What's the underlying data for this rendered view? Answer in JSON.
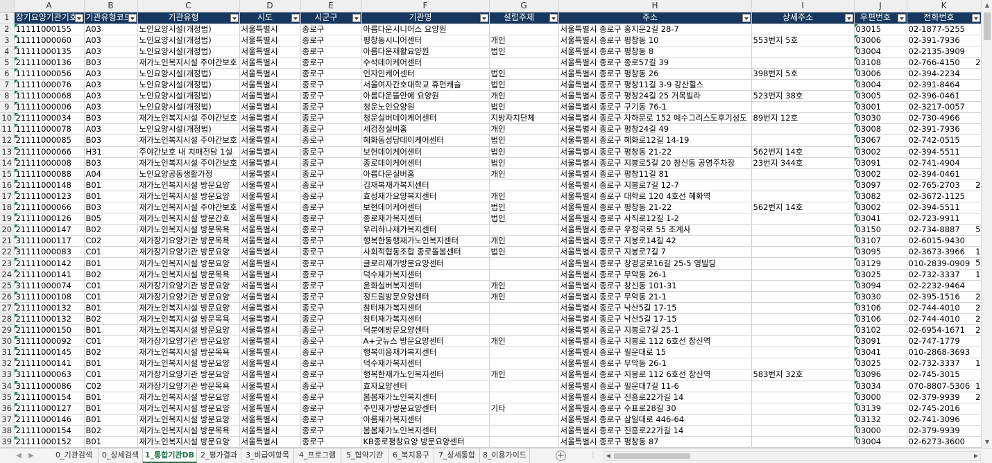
{
  "columns": [
    "A",
    "B",
    "C",
    "D",
    "E",
    "F",
    "G",
    "H",
    "I",
    "J",
    "K"
  ],
  "headers": [
    "장기요양기관기호",
    "기관유형코드",
    "기관유형",
    "시도",
    "시군구",
    "기관명",
    "설립주체",
    "주소",
    "상세주소",
    "우편번호",
    "전화번호"
  ],
  "rows": [
    [
      "11111000155",
      "A03",
      "노인요양시설(개정법)",
      "서울특별시",
      "종로구",
      "아름다운시니어스 요양원",
      "",
      "서울특별시 종로구 홍지문2길 28-7",
      "",
      "03015",
      "02-1877-5255",
      ""
    ],
    [
      "11111000060",
      "A03",
      "노인요양시설(개정법)",
      "서울특별시",
      "종로구",
      "평창동시니어센터",
      "개인",
      "서울특별시 종로구 평창동 10",
      "553번지 5호",
      "03006",
      "02-391-7936",
      ""
    ],
    [
      "11111000135",
      "A03",
      "노인요양시설(개정법)",
      "서울특별시",
      "종로구",
      "아름다운재활요양원",
      "법인",
      "서울특별시 종로구 평창동 8",
      "",
      "03004",
      "02-2135-3909",
      ""
    ],
    [
      "21111000136",
      "B03",
      "재가노인복지시설 주야간보호",
      "서울특별시",
      "종로구",
      "수석데이케어센터",
      "",
      "서울특별시 종로구 종로57길 39",
      "",
      "03108",
      "02-766-4150",
      "2"
    ],
    [
      "11111000056",
      "A03",
      "노인요양시설(개정법)",
      "서울특별시",
      "종로구",
      "인자인케어센터",
      "법인",
      "서울특별시 종로구 평창동 26",
      "398번지 5호",
      "03006",
      "02-394-2234",
      ""
    ],
    [
      "11111000076",
      "A03",
      "노인요양시설(개정법)",
      "서울특별시",
      "종로구",
      "서울여자간호대학교 휴먼캐슬",
      "법인",
      "서울특별시 종로구 평창11길 3-9 강산힐스",
      "",
      "03004",
      "02-391-8464",
      ""
    ],
    [
      "11111000068",
      "A03",
      "노인요양시설(개정법)",
      "서울특별시",
      "종로구",
      "아름다운뜰안에 요양원",
      "개인",
      "서울특별시 종로구 평창24길 25 거목빌라",
      "523번지 38호",
      "03005",
      "02-396-0461",
      ""
    ],
    [
      "11111000006",
      "A03",
      "노인요양시설(개정법)",
      "서울특별시",
      "종로구",
      "청운노인요양원",
      "법인",
      "서울특별시 종로구 구기동 76-1",
      "",
      "03001",
      "02-3217-0057",
      ""
    ],
    [
      "21111000034",
      "B03",
      "재가노인복지시설 주야간보호",
      "서울특별시",
      "종로구",
      "청운실버데이케어센터",
      "지방자치단체",
      "서울특별시 종로구 자하문로 152 예수그리스도후기성도",
      "89번지 12호",
      "03030",
      "02-730-4966",
      ""
    ],
    [
      "11111000078",
      "A03",
      "노인요양시설(개정법)",
      "서울특별시",
      "종로구",
      "세검정실버홈",
      "개인",
      "서울특별시 종로구 평창24길 49",
      "",
      "03008",
      "02-391-7936",
      ""
    ],
    [
      "21111000085",
      "B03",
      "재가노인복지시설 주야간보호",
      "서울특별시",
      "종로구",
      "혜화동성당데이케어센터",
      "법인",
      "서울특별시 종로구 혜화로12길 14-19",
      "",
      "03067",
      "02-742-0515",
      ""
    ],
    [
      "21111000066",
      "H31",
      "주야간보호 내 치매전담 1실",
      "서울특별시",
      "종로구",
      "보현데이케어센터",
      "법인",
      "서울특별시 종로구 평창동 21-22",
      "562번지 14호",
      "03002",
      "02-394-5511",
      ""
    ],
    [
      "21111000008",
      "B03",
      "재가노인복지시설 주야간보호",
      "서울특별시",
      "종로구",
      "종로데이케어센터",
      "법인",
      "서울특별시 종로구 지봉로5길 20 창신동 공영주차장",
      "23번지 344호",
      "03091",
      "02-741-4904",
      ""
    ],
    [
      "11111000088",
      "A04",
      "노인요양공동생활가정",
      "서울특별시",
      "종로구",
      "아름다운실버홈",
      "개인",
      "서울특별시 종로구 평창11길 81",
      "",
      "03002",
      "02-394-0461",
      ""
    ],
    [
      "21111000148",
      "B01",
      "재가노인복지시설 방문요양",
      "서울특별시",
      "종로구",
      "김재복재가복지센터",
      "",
      "서울특별시 종로구 지봉로7길 12-7",
      "",
      "03097",
      "02-765-2703",
      "2"
    ],
    [
      "21111000123",
      "B01",
      "재가노인복지시설 방문요양",
      "서울특별시",
      "종로구",
      "효성재가요양복지센터",
      "개인",
      "서울특별시 종로구 대학로 120 4호선 혜화역",
      "",
      "03082",
      "02-3672-1125",
      ""
    ],
    [
      "21111000066",
      "B03",
      "재가노인복지시설 주야간보호",
      "서울특별시",
      "종로구",
      "보현데이케어센터",
      "법인",
      "서울특별시 종로구 평창동 21-22",
      "562번지 14호",
      "03002",
      "02-394-5511",
      ""
    ],
    [
      "21111000126",
      "B05",
      "재가노인복지시설 방문간호",
      "서울특별시",
      "종로구",
      "종로재가복지센터",
      "법인",
      "서울특별시 종로구 사직로12길 1-2",
      "",
      "03041",
      "02-723-9911",
      ""
    ],
    [
      "21111000147",
      "B02",
      "재가노인복지시설 방문목욕",
      "서울특별시",
      "종로구",
      "우리하나재가복지센터",
      "",
      "서울특별시 종로구 우정국로 55 조계사",
      "",
      "03150",
      "02-734-8887",
      "5"
    ],
    [
      "31111000117",
      "C02",
      "재가장기요양기관 방문목욕",
      "서울특별시",
      "종로구",
      "행복한동행재가노인복지센터",
      "개인",
      "서울특별시 종로구 지봉로14길 42",
      "",
      "03107",
      "02-6015-9430",
      ""
    ],
    [
      "31111000083",
      "C01",
      "재가장기요양기관 방문요양",
      "서울특별시",
      "종로구",
      "사회적협동조합 종로돌봄센터",
      "법인",
      "서울특별시 종로구 지봉로7길 7",
      "",
      "03095",
      "02-3673-3966",
      "1"
    ],
    [
      "21111000142",
      "B01",
      "재가노인복지시설 방문요양",
      "서울특별시",
      "종로구",
      "글로리재가방문요양센터",
      "",
      "서울특별시 종로구 창경궁로16길 25-5 영빌딩",
      "",
      "03129",
      "010-2839-0909",
      "5"
    ],
    [
      "21111000141",
      "B02",
      "재가노인복지시설 방문목욕",
      "서울특별시",
      "종로구",
      "덕수재가복지센터",
      "",
      "서울특별시 종로구 무악동 26-1",
      "",
      "03025",
      "02-732-3337",
      "1"
    ],
    [
      "31111000074",
      "C01",
      "재가장기요양기관 방문요양",
      "서울특별시",
      "종로구",
      "윤화실버복지센터",
      "개인",
      "서울특별시 종로구 창신동 101-31",
      "",
      "03094",
      "02-2232-9464",
      ""
    ],
    [
      "31111000108",
      "C01",
      "재가장기요양기관 방문요양",
      "서울특별시",
      "종로구",
      "정드림방문요양센터",
      "개인",
      "서울특별시 종로구 무악동 21-1",
      "",
      "03030",
      "02-395-1516",
      "2"
    ],
    [
      "21111000132",
      "B01",
      "재가노인복지시설 방문요양",
      "서울특별시",
      "종로구",
      "참터재가복지센터",
      "",
      "서울특별시 종로구 낙산5길 17-15",
      "",
      "03106",
      "02-744-4010",
      "2"
    ],
    [
      "21111000132",
      "B02",
      "재가노인복지시설 방문목욕",
      "서울특별시",
      "종로구",
      "참터재가복지센터",
      "",
      "서울특별시 종로구 낙산5길 17-15",
      "",
      "03106",
      "02-744-4010",
      "2"
    ],
    [
      "21111000150",
      "B01",
      "재가노인복지시설 방문요양",
      "서울특별시",
      "종로구",
      "덕분에방문요양센터",
      "",
      "서울특별시 종로구 지봉로7길 25-1",
      "",
      "03102",
      "02-6954-1671",
      "2"
    ],
    [
      "31111000092",
      "C01",
      "재가장기요양기관 방문요양",
      "서울특별시",
      "종로구",
      "A+굿뉴스 방문요양센터",
      "개인",
      "서울특별시 종로구 지봉로 112 6호선 창신역",
      "",
      "03091",
      "02-747-1779",
      ""
    ],
    [
      "21111000145",
      "B02",
      "재가노인복지시설 방문목욕",
      "서울특별시",
      "종로구",
      "행복이음재가복지센터",
      "",
      "서울특별시 종로구 필운대로 15",
      "",
      "03041",
      "010-2868-3693",
      ""
    ],
    [
      "21111000141",
      "B01",
      "재가노인복지시설 방문요양",
      "서울특별시",
      "종로구",
      "덕수재가복지센터",
      "",
      "서울특별시 종로구 무악동 26-1",
      "",
      "03025",
      "02-732-3337",
      "1"
    ],
    [
      "31111000063",
      "C01",
      "재가장기요양기관 방문요양",
      "서울특별시",
      "종로구",
      "행복한재가노인복지센터",
      "개인",
      "서울특별시 종로구 지봉로 112 6호선 창신역",
      "583번지 32호",
      "03096",
      "02-745-3015",
      ""
    ],
    [
      "31111000086",
      "C02",
      "재가장기요양기관 방문목욕",
      "서울특별시",
      "종로구",
      "효자요양센터",
      "",
      "서울특별시 종로구 필운대7길 11-6",
      "",
      "03034",
      "070-8807-5306",
      "1"
    ],
    [
      "21111000154",
      "B01",
      "재가노인복지시설 방문요양",
      "서울특별시",
      "종로구",
      "봄봄재가노인복지센터",
      "",
      "서울특별시 종로구 진흥로22가길 14",
      "",
      "03000",
      "02-379-9939",
      "2"
    ],
    [
      "21111000127",
      "B01",
      "재가노인복지시설 방문요양",
      "서울특별시",
      "종로구",
      "주민재가방문요양센터",
      "기타",
      "서울특별시 종로구 수표로28길 30",
      "",
      "03139",
      "02-745-2016",
      ""
    ],
    [
      "21111000146",
      "B01",
      "재가노인복지시설 방문요양",
      "서울특별시",
      "종로구",
      "아름재가복지센터",
      "",
      "서울특별시 종로구 삼일대로 446-64",
      "",
      "03132",
      "02-741-3096",
      ""
    ],
    [
      "21111000154",
      "B02",
      "재가노인복지시설 방문목욕",
      "서울특별시",
      "종로구",
      "봄봄재가노인복지센터",
      "",
      "서울특별시 종로구 진흥로22가길 14",
      "",
      "03000",
      "02-379-9939",
      ""
    ],
    [
      "21111000152",
      "B01",
      "재가노인복지시설 방문요양",
      "서울특별시",
      "종로구",
      "KB종로평창요양 방문요양센터",
      "",
      "서울특별시 종로구 평창동 87",
      "",
      "03004",
      "02-6273-3600",
      ""
    ]
  ],
  "tabs": [
    "0_기관검색",
    "0_상세검색",
    "1_통합기관DB",
    "2_평가결과",
    "3_비급여항목",
    "4_프로그램",
    "5_협약기관",
    "6_복지용구",
    "7_상세통합",
    "8_이용가이드"
  ],
  "active_tab": "1_통합기관DB",
  "add_sheet_label": "+",
  "ellipsis": "⋮"
}
